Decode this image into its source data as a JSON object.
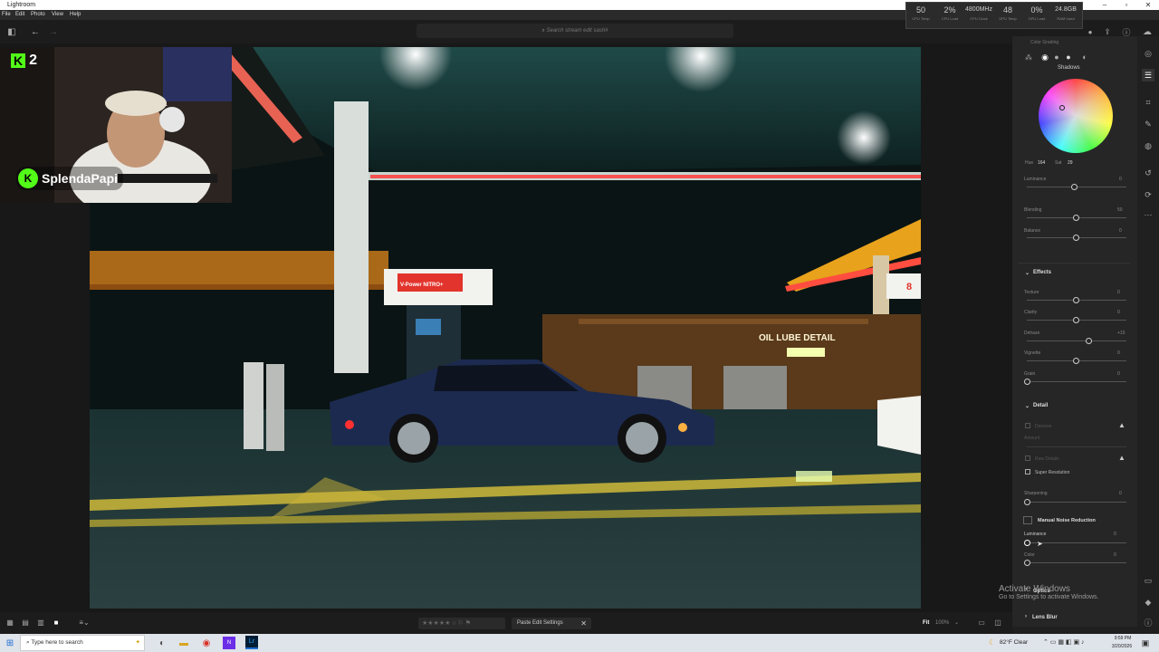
{
  "app": {
    "title": "Lightroom"
  },
  "menu": [
    "File",
    "Edit",
    "Photo",
    "View",
    "Help"
  ],
  "stats": [
    {
      "value": "50",
      "label": "CPU Temp"
    },
    {
      "value": "2%",
      "label": "CPU Load"
    },
    {
      "value": "4800MHz",
      "label": "CPU Clock"
    },
    {
      "value": "48",
      "label": "GPU Temp"
    },
    {
      "value": "0%",
      "label": "GPU Load"
    },
    {
      "value": "24.8GB",
      "label": "RAM Used"
    }
  ],
  "search": {
    "placeholder": "Search stream edit sash#"
  },
  "webcam": {
    "streamer": "SplendaPapi",
    "badge": "K 2"
  },
  "photo": {
    "station_sign": "V-Power NITRO+",
    "store_sign": "OIL   LUBE   DETAIL",
    "pump_number": "8"
  },
  "panel": {
    "color_grading_title": "Color Grading",
    "wheel_title": "Shadows",
    "hue_label": "Hue",
    "hue_value": "164",
    "sat_label": "Sat",
    "sat_value": "29",
    "luminance_label": "Luminance",
    "luminance_value": "0",
    "blending_label": "Blending",
    "blending_value": "50",
    "balance_label": "Balance",
    "balance_value": "0",
    "effects_title": "Effects",
    "effects": [
      {
        "label": "Texture",
        "value": "0",
        "pos": 0.5
      },
      {
        "label": "Clarity",
        "value": "0",
        "pos": 0.5
      },
      {
        "label": "Dehaze",
        "value": "+15",
        "pos": 0.63
      },
      {
        "label": "Vignette",
        "value": "0",
        "pos": 0.5
      },
      {
        "label": "Grain",
        "value": "0",
        "pos": 0.0
      }
    ],
    "detail_title": "Detail",
    "denoise_label": "Denoise",
    "amount_label": "Amount",
    "raw_details_label": "Raw Details",
    "super_resolution_label": "Super Resolution",
    "sharpening_label": "Sharpening",
    "sharpening_value": "0",
    "manual_nr_title": "Manual Noise Reduction",
    "nr_luminance_label": "Luminance",
    "nr_luminance_value": "0",
    "nr_color_label": "Color",
    "nr_color_value": "0",
    "optics_title": "Optics",
    "lens_blur_title": "Lens Blur"
  },
  "watermark": {
    "line1": "Activate Windows",
    "line2": "Go to Settings to activate Windows."
  },
  "bottombar": {
    "stars": "★★★★★",
    "paste_label": "Paste Edit Settings",
    "fit_label": "Fit",
    "zoom": "100%"
  },
  "taskbar": {
    "search_placeholder": "Type here to search",
    "weather": "82°F  Clear",
    "time": "9:59 PM",
    "date": "3/20/2026"
  }
}
